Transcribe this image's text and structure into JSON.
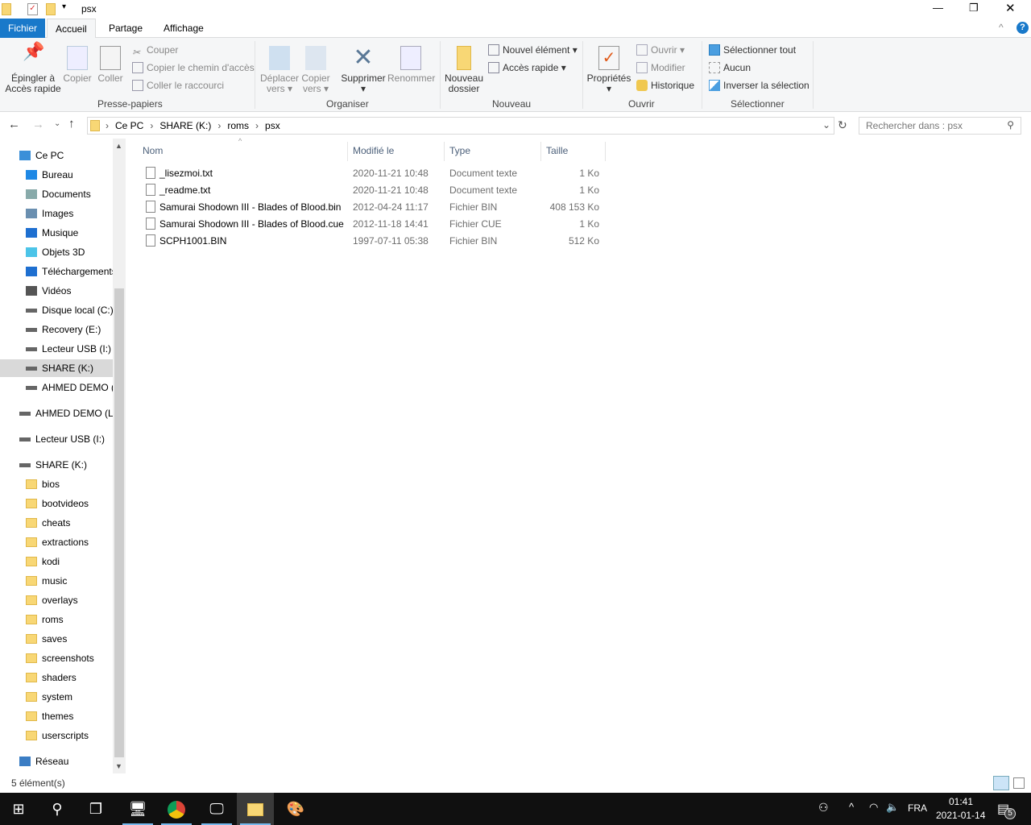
{
  "window": {
    "title": "psx",
    "minimize": "—",
    "restore": "❐",
    "close": "✕",
    "help": "?",
    "collapse": "^"
  },
  "tabs": [
    "Fichier",
    "Accueil",
    "Partage",
    "Affichage"
  ],
  "ribbon": {
    "clipboard": {
      "pin": "Épingler à",
      "pin2": "Accès rapide",
      "copy": "Copier",
      "paste": "Coller",
      "cut": "Couper",
      "copy_path": "Copier le chemin d'accès",
      "paste_shortcut": "Coller le raccourci",
      "label": "Presse-papiers"
    },
    "organize": {
      "move": "Déplacer",
      "move2": "vers",
      "copyto": "Copier",
      "copyto2": "vers",
      "delete": "Supprimer",
      "rename": "Renommer",
      "label": "Organiser"
    },
    "new": {
      "new_folder": "Nouveau",
      "new_folder2": "dossier",
      "new_item": "Nouvel élément",
      "easy_access": "Accès rapide",
      "label": "Nouveau"
    },
    "open": {
      "properties": "Propriétés",
      "open": "Ouvrir",
      "edit": "Modifier",
      "history": "Historique",
      "label": "Ouvrir"
    },
    "select": {
      "all": "Sélectionner tout",
      "none": "Aucun",
      "invert": "Inverser la sélection",
      "label": "Sélectionner"
    }
  },
  "address": {
    "crumbs": [
      "Ce PC",
      "SHARE (K:)",
      "roms",
      "psx"
    ],
    "search_placeholder": "Rechercher dans : psx"
  },
  "nav": [
    {
      "label": "Ce PC",
      "icon": "pc-icon",
      "level": 0
    },
    {
      "label": "Bureau",
      "icon": "desktop-icon",
      "level": 1
    },
    {
      "label": "Documents",
      "icon": "documents-icon",
      "level": 1
    },
    {
      "label": "Images",
      "icon": "images-icon",
      "level": 1
    },
    {
      "label": "Musique",
      "icon": "music-icon",
      "level": 1
    },
    {
      "label": "Objets 3D",
      "icon": "3d-objects-icon",
      "level": 1
    },
    {
      "label": "Téléchargements",
      "icon": "downloads-icon",
      "level": 1
    },
    {
      "label": "Vidéos",
      "icon": "videos-icon",
      "level": 1
    },
    {
      "label": "Disque local (C:)",
      "icon": "drive-icon",
      "level": 1
    },
    {
      "label": "Recovery (E:)",
      "icon": "drive-icon",
      "level": 1
    },
    {
      "label": "Lecteur USB (I:)",
      "icon": "drive-icon",
      "level": 1
    },
    {
      "label": "SHARE (K:)",
      "icon": "drive-icon",
      "level": 1,
      "selected": true
    },
    {
      "label": "AHMED DEMO (L:)",
      "icon": "drive-icon",
      "level": 1
    },
    {
      "label": "AHMED DEMO (L:)",
      "icon": "drive-icon",
      "level": 0,
      "gap": true
    },
    {
      "label": "Lecteur USB (I:)",
      "icon": "drive-icon",
      "level": 0,
      "gap": true
    },
    {
      "label": "SHARE (K:)",
      "icon": "drive-icon",
      "level": 0,
      "gap": true
    },
    {
      "label": "bios",
      "icon": "folder-icon",
      "level": 1
    },
    {
      "label": "bootvideos",
      "icon": "folder-icon",
      "level": 1
    },
    {
      "label": "cheats",
      "icon": "folder-icon",
      "level": 1
    },
    {
      "label": "extractions",
      "icon": "folder-icon",
      "level": 1
    },
    {
      "label": "kodi",
      "icon": "folder-icon",
      "level": 1
    },
    {
      "label": "music",
      "icon": "folder-icon",
      "level": 1
    },
    {
      "label": "overlays",
      "icon": "folder-icon",
      "level": 1
    },
    {
      "label": "roms",
      "icon": "folder-icon",
      "level": 1
    },
    {
      "label": "saves",
      "icon": "folder-icon",
      "level": 1
    },
    {
      "label": "screenshots",
      "icon": "folder-icon",
      "level": 1
    },
    {
      "label": "shaders",
      "icon": "folder-icon",
      "level": 1
    },
    {
      "label": "system",
      "icon": "folder-icon",
      "level": 1
    },
    {
      "label": "themes",
      "icon": "folder-icon",
      "level": 1
    },
    {
      "label": "userscripts",
      "icon": "folder-icon",
      "level": 1
    },
    {
      "label": "Réseau",
      "icon": "network-icon",
      "level": 0,
      "gap": true
    }
  ],
  "columns": [
    "Nom",
    "Modifié le",
    "Type",
    "Taille"
  ],
  "files": [
    {
      "name": "_lisezmoi.txt",
      "modified": "2020-11-21 10:48",
      "type": "Document texte",
      "size": "1 Ko"
    },
    {
      "name": "_readme.txt",
      "modified": "2020-11-21 10:48",
      "type": "Document texte",
      "size": "1 Ko"
    },
    {
      "name": "Samurai Shodown III - Blades of Blood.bin",
      "modified": "2012-04-24 11:17",
      "type": "Fichier BIN",
      "size": "408 153 Ko"
    },
    {
      "name": "Samurai Shodown III - Blades of Blood.cue",
      "modified": "2012-11-18 14:41",
      "type": "Fichier CUE",
      "size": "1 Ko"
    },
    {
      "name": "SCPH1001.BIN",
      "modified": "1997-07-11 05:38",
      "type": "Fichier BIN",
      "size": "512 Ko"
    }
  ],
  "status": "5 élément(s)",
  "taskbar": {
    "language": "FRA",
    "time": "01:41",
    "date": "2021-01-14",
    "notifications": "5"
  },
  "colors": {
    "accent": "#1979ca",
    "selected": "#d9d9d9",
    "taskbar": "#101010"
  }
}
